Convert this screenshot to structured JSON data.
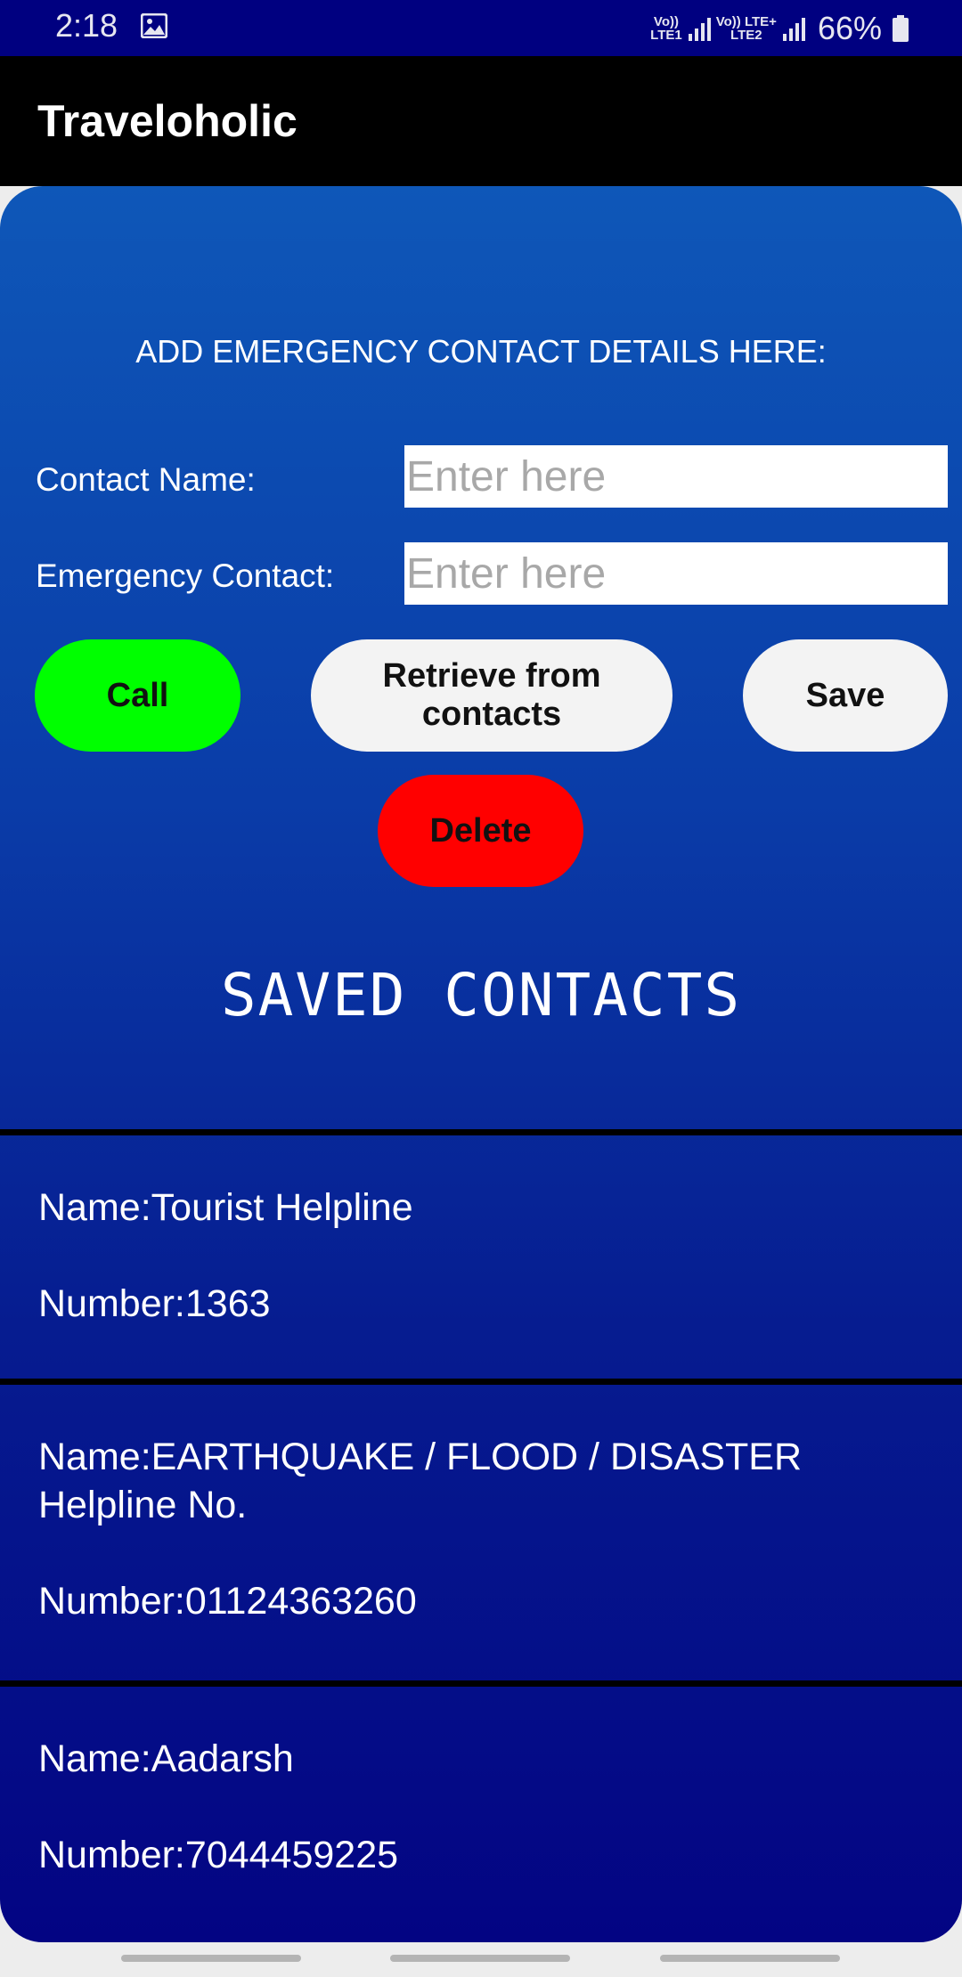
{
  "status_bar": {
    "time": "2:18",
    "sim1_top": "Vo))",
    "sim1_bottom": "LTE1",
    "sim2_top": "Vo)) LTE+",
    "sim2_bottom": "LTE2",
    "battery": "66%",
    "icons": [
      "image-icon",
      "signal-icon",
      "battery-icon"
    ]
  },
  "app_bar": {
    "title": "Traveloholic"
  },
  "form": {
    "heading": "ADD EMERGENCY CONTACT DETAILS HERE:",
    "contact_name_label": "Contact Name:",
    "contact_name_placeholder": "Enter here",
    "contact_name_value": "",
    "emergency_contact_label": "Emergency Contact:",
    "emergency_contact_placeholder": "Enter here",
    "emergency_contact_value": ""
  },
  "buttons": {
    "call": "Call",
    "retrieve": "Retrieve from contacts",
    "save": "Save",
    "delete": "Delete"
  },
  "colors": {
    "call_button": "#00ff00",
    "delete_button": "#ff0000",
    "neutral_button": "#f3f3f3",
    "status_bar": "#000080",
    "app_bar": "#000000"
  },
  "saved_contacts": {
    "title": "SAVED CONTACTS",
    "items": [
      {
        "name": "Name:Tourist Helpline",
        "number": "Number:1363"
      },
      {
        "name": "Name:EARTHQUAKE / FLOOD / DISASTER Helpline No.",
        "number": "Number:01124363260"
      },
      {
        "name": "Name:Aadarsh",
        "number": "Number:7044459225"
      }
    ]
  }
}
